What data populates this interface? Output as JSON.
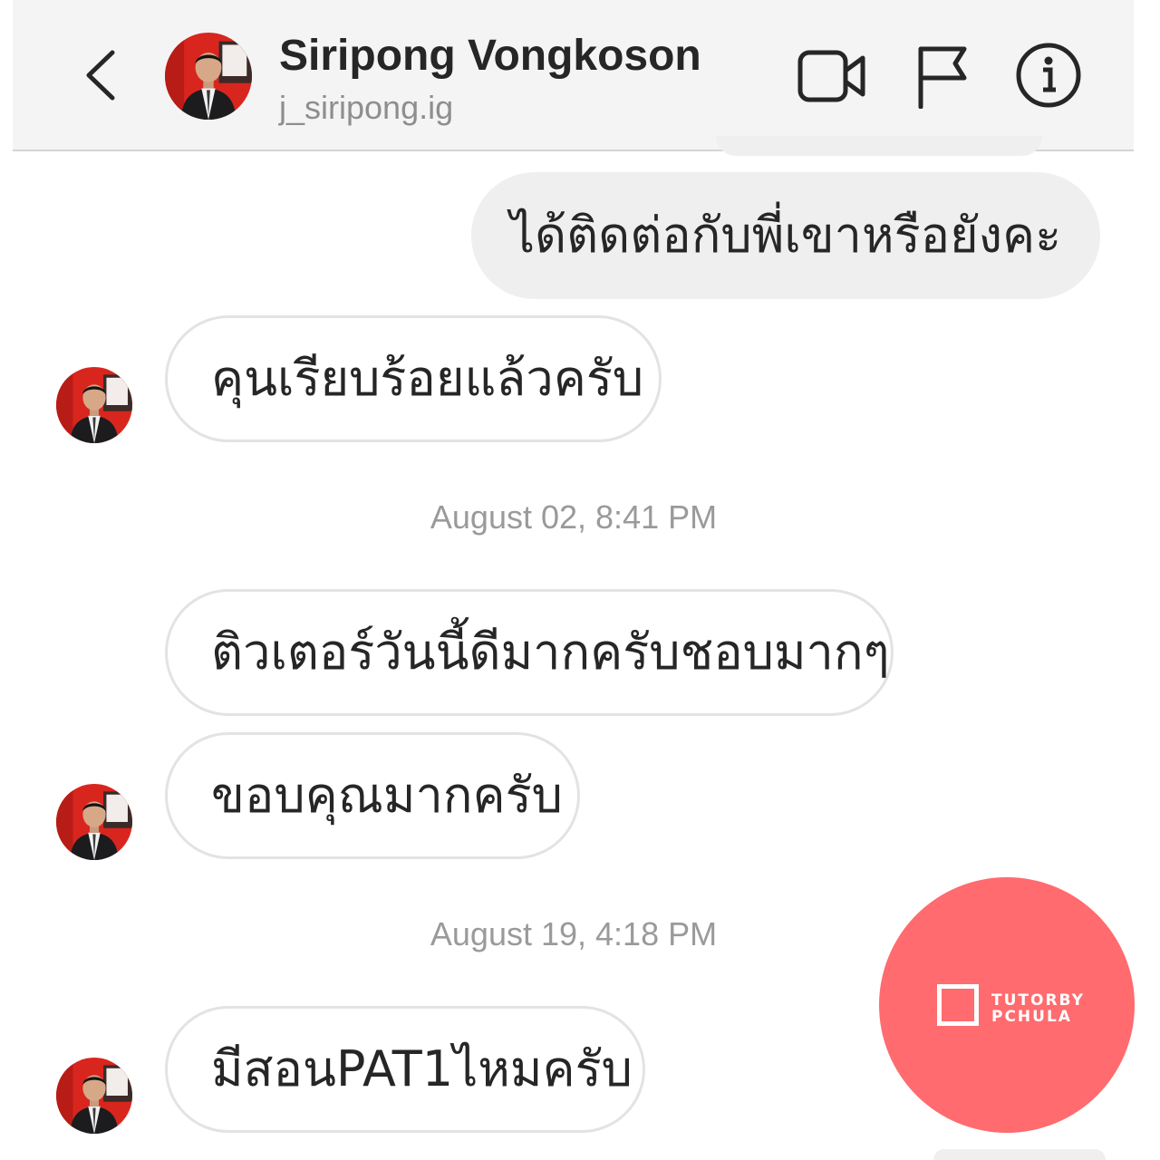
{
  "header": {
    "name": "Siripong Vongkoson",
    "handle": "j_siripong.ig",
    "icons": [
      "chevron-left-icon",
      "video-call-icon",
      "flag-icon",
      "info-icon"
    ]
  },
  "messages": [
    {
      "side": "outgoing",
      "text": "ได้ติดต่อกับพี่เขาหรือยังคะ"
    },
    {
      "side": "incoming",
      "text": "คุนเรียบร้อยแล้วครับ"
    },
    {
      "type": "timestamp",
      "text": "August 02, 8:41 PM"
    },
    {
      "side": "incoming",
      "text": "ติวเตอร์วันนี้ดีมากครับชอบมากๆ"
    },
    {
      "side": "incoming",
      "text": "ขอบคุณมากครับ"
    },
    {
      "type": "timestamp",
      "text": "August 19, 4:18 PM"
    },
    {
      "side": "incoming",
      "text": "มีสอนPAT1ไหมครับ"
    }
  ],
  "promo": {
    "line1": "TUTORBY",
    "line2": "PCHULA"
  },
  "colors": {
    "promo_bg": "#ff6b6e",
    "outgoing_bubble": "#efefef",
    "incoming_border": "#e3e3e3"
  }
}
